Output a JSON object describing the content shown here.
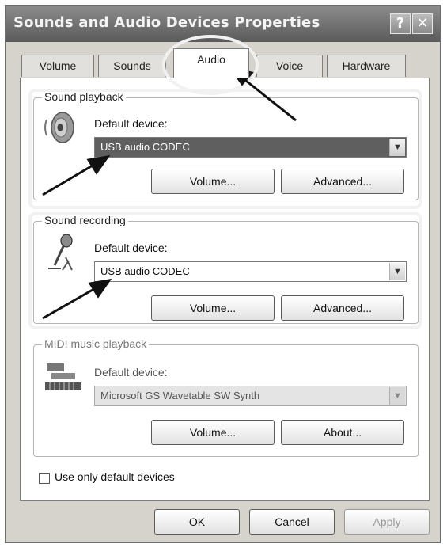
{
  "window": {
    "title": "Sounds and Audio Devices Properties"
  },
  "titlebar_buttons": {
    "help": "?",
    "close": "✕"
  },
  "tabs": [
    {
      "label": "Volume"
    },
    {
      "label": "Sounds"
    },
    {
      "label": "Audio"
    },
    {
      "label": "Voice"
    },
    {
      "label": "Hardware"
    }
  ],
  "active_tab": "Audio",
  "sound_playback": {
    "group_label": "Sound playback",
    "device_label": "Default device:",
    "selected_device": "USB audio CODEC",
    "volume_button": "Volume...",
    "advanced_button": "Advanced..."
  },
  "sound_recording": {
    "group_label": "Sound recording",
    "device_label": "Default device:",
    "selected_device": "USB audio CODEC",
    "volume_button": "Volume...",
    "advanced_button": "Advanced..."
  },
  "midi_playback": {
    "group_label": "MIDI music playback",
    "device_label": "Default device:",
    "selected_device": "Microsoft GS Wavetable SW Synth",
    "volume_button": "Volume...",
    "about_button": "About..."
  },
  "options": {
    "use_only_default_label": "Use only default devices",
    "use_only_default_checked": false
  },
  "footer": {
    "ok": "OK",
    "cancel": "Cancel",
    "apply": "Apply"
  }
}
